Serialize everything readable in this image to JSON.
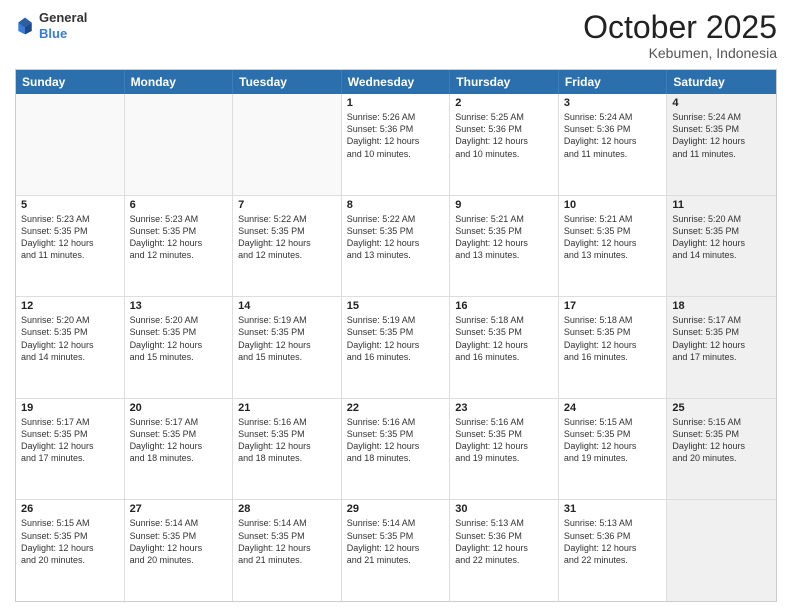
{
  "header": {
    "logo_general": "General",
    "logo_blue": "Blue",
    "month_title": "October 2025",
    "location": "Kebumen, Indonesia"
  },
  "weekdays": [
    "Sunday",
    "Monday",
    "Tuesday",
    "Wednesday",
    "Thursday",
    "Friday",
    "Saturday"
  ],
  "rows": [
    [
      {
        "day": "",
        "text": "",
        "empty": true
      },
      {
        "day": "",
        "text": "",
        "empty": true
      },
      {
        "day": "",
        "text": "",
        "empty": true
      },
      {
        "day": "1",
        "text": "Sunrise: 5:26 AM\nSunset: 5:36 PM\nDaylight: 12 hours\nand 10 minutes.",
        "empty": false
      },
      {
        "day": "2",
        "text": "Sunrise: 5:25 AM\nSunset: 5:36 PM\nDaylight: 12 hours\nand 10 minutes.",
        "empty": false
      },
      {
        "day": "3",
        "text": "Sunrise: 5:24 AM\nSunset: 5:36 PM\nDaylight: 12 hours\nand 11 minutes.",
        "empty": false
      },
      {
        "day": "4",
        "text": "Sunrise: 5:24 AM\nSunset: 5:35 PM\nDaylight: 12 hours\nand 11 minutes.",
        "empty": false,
        "shaded": true
      }
    ],
    [
      {
        "day": "5",
        "text": "Sunrise: 5:23 AM\nSunset: 5:35 PM\nDaylight: 12 hours\nand 11 minutes.",
        "empty": false
      },
      {
        "day": "6",
        "text": "Sunrise: 5:23 AM\nSunset: 5:35 PM\nDaylight: 12 hours\nand 12 minutes.",
        "empty": false
      },
      {
        "day": "7",
        "text": "Sunrise: 5:22 AM\nSunset: 5:35 PM\nDaylight: 12 hours\nand 12 minutes.",
        "empty": false
      },
      {
        "day": "8",
        "text": "Sunrise: 5:22 AM\nSunset: 5:35 PM\nDaylight: 12 hours\nand 13 minutes.",
        "empty": false
      },
      {
        "day": "9",
        "text": "Sunrise: 5:21 AM\nSunset: 5:35 PM\nDaylight: 12 hours\nand 13 minutes.",
        "empty": false
      },
      {
        "day": "10",
        "text": "Sunrise: 5:21 AM\nSunset: 5:35 PM\nDaylight: 12 hours\nand 13 minutes.",
        "empty": false
      },
      {
        "day": "11",
        "text": "Sunrise: 5:20 AM\nSunset: 5:35 PM\nDaylight: 12 hours\nand 14 minutes.",
        "empty": false,
        "shaded": true
      }
    ],
    [
      {
        "day": "12",
        "text": "Sunrise: 5:20 AM\nSunset: 5:35 PM\nDaylight: 12 hours\nand 14 minutes.",
        "empty": false
      },
      {
        "day": "13",
        "text": "Sunrise: 5:20 AM\nSunset: 5:35 PM\nDaylight: 12 hours\nand 15 minutes.",
        "empty": false
      },
      {
        "day": "14",
        "text": "Sunrise: 5:19 AM\nSunset: 5:35 PM\nDaylight: 12 hours\nand 15 minutes.",
        "empty": false
      },
      {
        "day": "15",
        "text": "Sunrise: 5:19 AM\nSunset: 5:35 PM\nDaylight: 12 hours\nand 16 minutes.",
        "empty": false
      },
      {
        "day": "16",
        "text": "Sunrise: 5:18 AM\nSunset: 5:35 PM\nDaylight: 12 hours\nand 16 minutes.",
        "empty": false
      },
      {
        "day": "17",
        "text": "Sunrise: 5:18 AM\nSunset: 5:35 PM\nDaylight: 12 hours\nand 16 minutes.",
        "empty": false
      },
      {
        "day": "18",
        "text": "Sunrise: 5:17 AM\nSunset: 5:35 PM\nDaylight: 12 hours\nand 17 minutes.",
        "empty": false,
        "shaded": true
      }
    ],
    [
      {
        "day": "19",
        "text": "Sunrise: 5:17 AM\nSunset: 5:35 PM\nDaylight: 12 hours\nand 17 minutes.",
        "empty": false
      },
      {
        "day": "20",
        "text": "Sunrise: 5:17 AM\nSunset: 5:35 PM\nDaylight: 12 hours\nand 18 minutes.",
        "empty": false
      },
      {
        "day": "21",
        "text": "Sunrise: 5:16 AM\nSunset: 5:35 PM\nDaylight: 12 hours\nand 18 minutes.",
        "empty": false
      },
      {
        "day": "22",
        "text": "Sunrise: 5:16 AM\nSunset: 5:35 PM\nDaylight: 12 hours\nand 18 minutes.",
        "empty": false
      },
      {
        "day": "23",
        "text": "Sunrise: 5:16 AM\nSunset: 5:35 PM\nDaylight: 12 hours\nand 19 minutes.",
        "empty": false
      },
      {
        "day": "24",
        "text": "Sunrise: 5:15 AM\nSunset: 5:35 PM\nDaylight: 12 hours\nand 19 minutes.",
        "empty": false
      },
      {
        "day": "25",
        "text": "Sunrise: 5:15 AM\nSunset: 5:35 PM\nDaylight: 12 hours\nand 20 minutes.",
        "empty": false,
        "shaded": true
      }
    ],
    [
      {
        "day": "26",
        "text": "Sunrise: 5:15 AM\nSunset: 5:35 PM\nDaylight: 12 hours\nand 20 minutes.",
        "empty": false
      },
      {
        "day": "27",
        "text": "Sunrise: 5:14 AM\nSunset: 5:35 PM\nDaylight: 12 hours\nand 20 minutes.",
        "empty": false
      },
      {
        "day": "28",
        "text": "Sunrise: 5:14 AM\nSunset: 5:35 PM\nDaylight: 12 hours\nand 21 minutes.",
        "empty": false
      },
      {
        "day": "29",
        "text": "Sunrise: 5:14 AM\nSunset: 5:35 PM\nDaylight: 12 hours\nand 21 minutes.",
        "empty": false
      },
      {
        "day": "30",
        "text": "Sunrise: 5:13 AM\nSunset: 5:36 PM\nDaylight: 12 hours\nand 22 minutes.",
        "empty": false
      },
      {
        "day": "31",
        "text": "Sunrise: 5:13 AM\nSunset: 5:36 PM\nDaylight: 12 hours\nand 22 minutes.",
        "empty": false
      },
      {
        "day": "",
        "text": "",
        "empty": true,
        "shaded": true
      }
    ]
  ]
}
